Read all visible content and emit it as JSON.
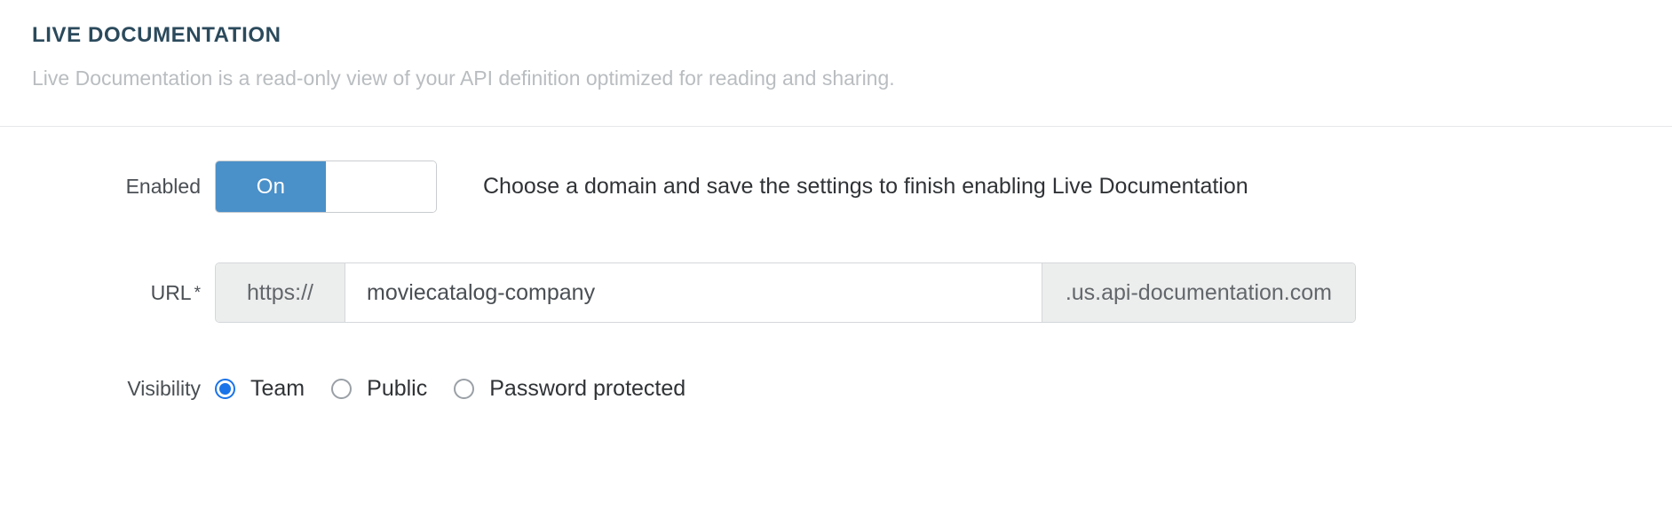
{
  "header": {
    "title": "LIVE DOCUMENTATION",
    "subtitle": "Live Documentation is a read-only view of your API definition optimized for reading and sharing."
  },
  "form": {
    "enabled": {
      "label": "Enabled",
      "toggle_on_label": "On",
      "toggle_state": "On",
      "helper_text": "Choose a domain and save the settings to finish enabling Live Documentation"
    },
    "url": {
      "label": "URL",
      "required_marker": "*",
      "prefix": "https://",
      "value": "moviecatalog-company",
      "placeholder": "",
      "suffix": ".us.api-documentation.com"
    },
    "visibility": {
      "label": "Visibility",
      "selected": "Team",
      "options": [
        {
          "label": "Team",
          "selected": true
        },
        {
          "label": "Public",
          "selected": false
        },
        {
          "label": "Password protected",
          "selected": false
        }
      ]
    }
  },
  "colors": {
    "title": "#2b4a5c",
    "subtitle": "#b9bdc0",
    "toggle_on": "#4a90c9",
    "radio_selected": "#1a73e8",
    "addon_bg": "#eceded",
    "border": "#d4d7da"
  }
}
